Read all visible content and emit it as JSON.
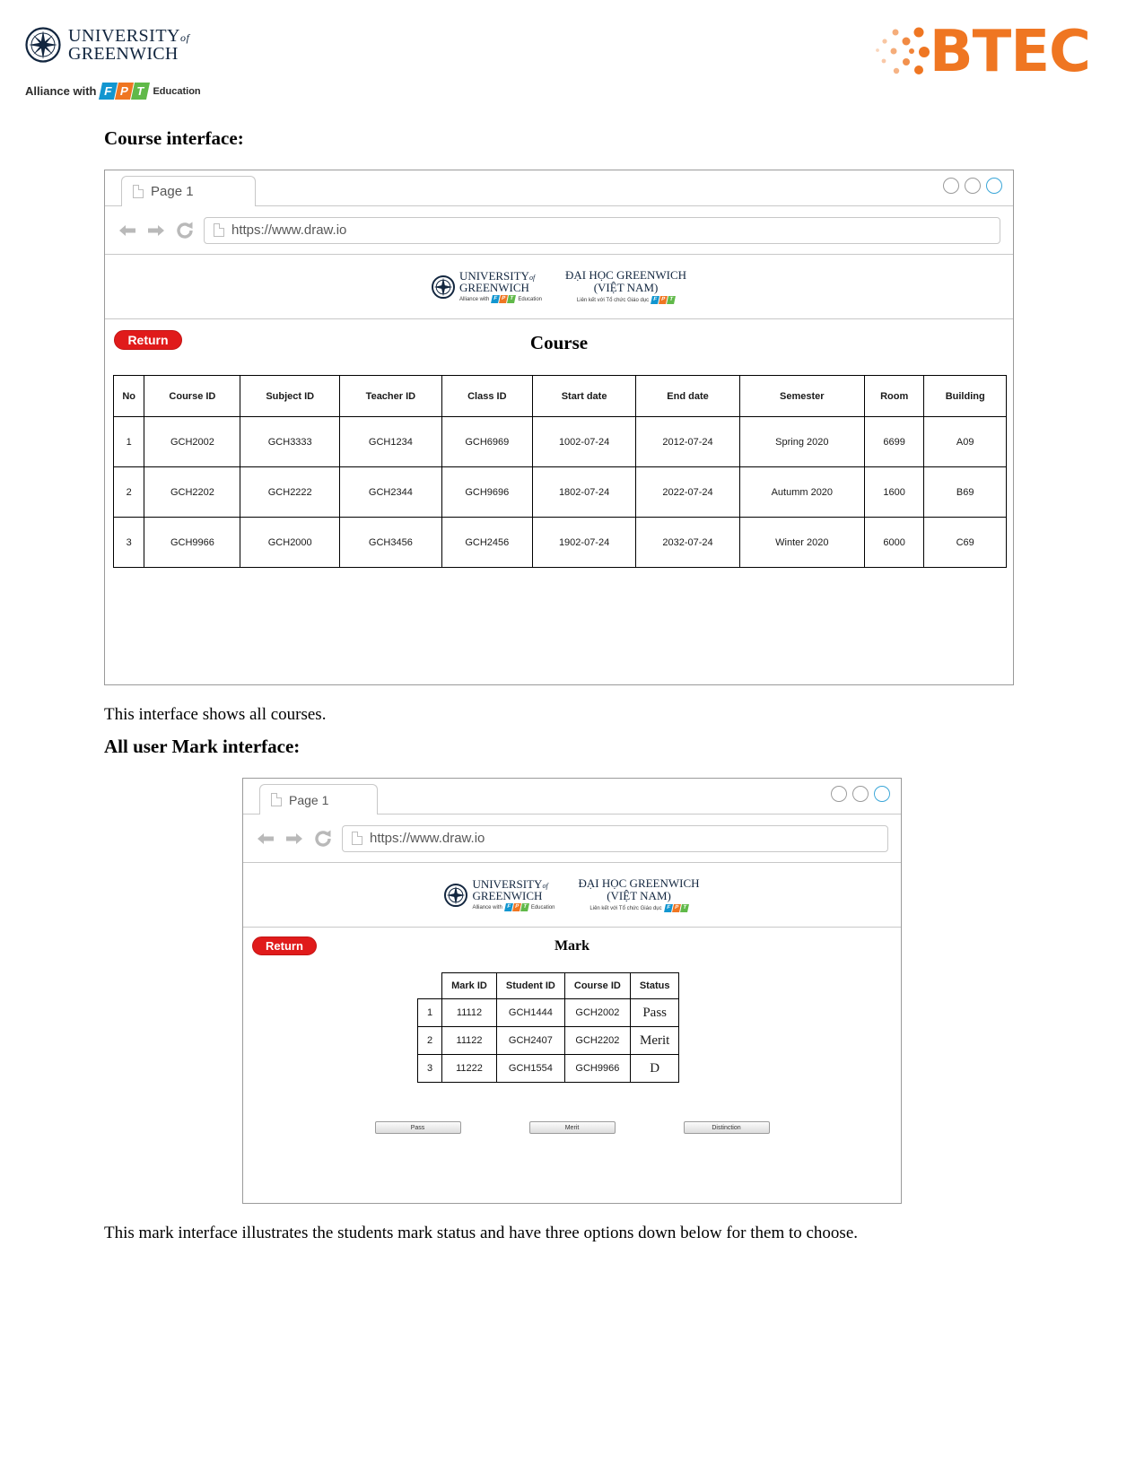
{
  "header": {
    "university_name_line1": "UNIVERSITY",
    "university_name_of": "of",
    "university_name_line2": "GREENWICH",
    "alliance_text": "Alliance with",
    "fpt_f": "F",
    "fpt_p": "P",
    "fpt_t": "T",
    "education_text": "Education",
    "btec_text": "BTEC"
  },
  "sections": {
    "course_heading": "Course interface:",
    "course_caption": "This interface shows all courses.",
    "mark_heading": "All user Mark interface:",
    "mark_caption": "This mark interface illustrates the students mark status and have three options down below for them to choose."
  },
  "browser": {
    "tab_label": "Page 1",
    "url": "https://www.draw.io",
    "back_icon": "back-arrow-icon",
    "forward_icon": "forward-arrow-icon",
    "reload_icon": "reload-icon",
    "doc_icon": "document-icon",
    "minimize_icon": "minimize-circle",
    "maximize_icon": "maximize-circle",
    "close_icon": "close-circle"
  },
  "app_banner": {
    "uog_line1": "UNIVERSITY",
    "uog_of": "of",
    "uog_line2": "GREENWICH",
    "uog_alliance": "Alliance with",
    "uog_alliance_suffix": "Education",
    "vn_line1": "ĐẠI HỌC GREENWICH",
    "vn_line2": "(VIỆT NAM)",
    "vn_sub": "Liên kết với Tổ chức Giáo dục"
  },
  "course_screen": {
    "return_label": "Return",
    "title": "Course",
    "columns": [
      "No",
      "Course ID",
      "Subject ID",
      "Teacher ID",
      "Class ID",
      "Start date",
      "End date",
      "Semester",
      "Room",
      "Building"
    ],
    "rows": [
      [
        "1",
        "GCH2002",
        "GCH3333",
        "GCH1234",
        "GCH6969",
        "1002-07-24",
        "2012-07-24",
        "Spring 2020",
        "6699",
        "A09"
      ],
      [
        "2",
        "GCH2202",
        "GCH2222",
        "GCH2344",
        "GCH9696",
        "1802-07-24",
        "2022-07-24",
        "Autumm 2020",
        "1600",
        "B69"
      ],
      [
        "3",
        "GCH9966",
        "GCH2000",
        "GCH3456",
        "GCH2456",
        "1902-07-24",
        "2032-07-24",
        "Winter 2020",
        "6000",
        "C69"
      ]
    ]
  },
  "mark_screen": {
    "return_label": "Return",
    "title": "Mark",
    "columns": [
      "",
      "Mark ID",
      "Student ID",
      "Course ID",
      "Status"
    ],
    "rows": [
      [
        "1",
        "11112",
        "GCH1444",
        "GCH2002",
        "Pass"
      ],
      [
        "2",
        "11122",
        "GCH2407",
        "GCH2202",
        "Merit"
      ],
      [
        "3",
        "11222",
        "GCH1554",
        "GCH9966",
        "D"
      ]
    ],
    "buttons": [
      "Pass",
      "Merit",
      "Distinction"
    ]
  },
  "colors": {
    "return_red": "#e01b1b",
    "btec_orange": "#ef7622",
    "uog_navy": "#12263f",
    "accent_circle": "#3aa6d8"
  }
}
